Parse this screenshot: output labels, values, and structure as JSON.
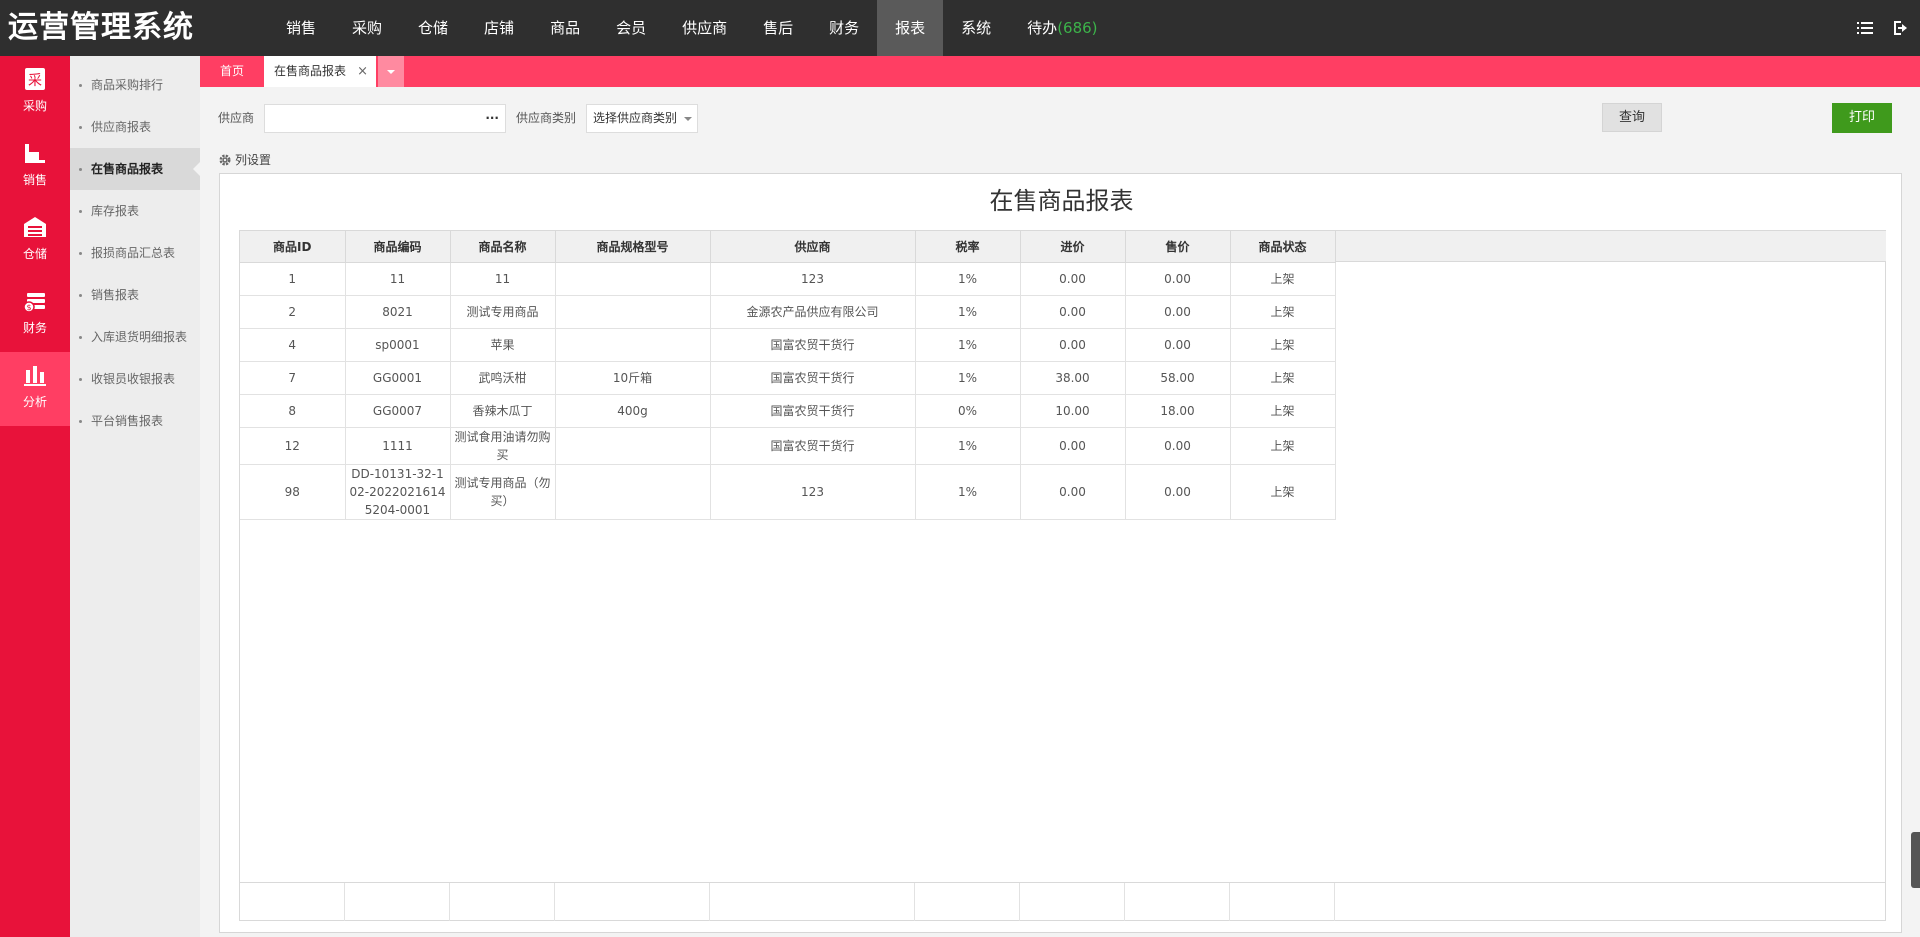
{
  "app": {
    "title": "运营管理系统"
  },
  "topnav": {
    "items": [
      {
        "label": "销售"
      },
      {
        "label": "采购"
      },
      {
        "label": "仓储"
      },
      {
        "label": "店铺"
      },
      {
        "label": "商品"
      },
      {
        "label": "会员"
      },
      {
        "label": "供应商"
      },
      {
        "label": "售后"
      },
      {
        "label": "财务"
      },
      {
        "label": "报表",
        "active": true
      },
      {
        "label": "系统"
      }
    ],
    "todo_label": "待办",
    "todo_count": "(686)"
  },
  "iconbar": {
    "items": [
      {
        "label": "采购",
        "icon": "purchase-icon"
      },
      {
        "label": "销售",
        "icon": "sales-icon"
      },
      {
        "label": "仓储",
        "icon": "warehouse-icon"
      },
      {
        "label": "财务",
        "icon": "finance-icon"
      },
      {
        "label": "分析",
        "icon": "bar-chart-icon",
        "active": true
      }
    ]
  },
  "submenu": {
    "items": [
      {
        "label": "商品采购排行"
      },
      {
        "label": "供应商报表"
      },
      {
        "label": "在售商品报表",
        "active": true
      },
      {
        "label": "库存报表"
      },
      {
        "label": "报损商品汇总表"
      },
      {
        "label": "销售报表"
      },
      {
        "label": "入库退货明细报表"
      },
      {
        "label": "收银员收银报表"
      },
      {
        "label": "平台销售报表"
      }
    ]
  },
  "tabs": {
    "home": "首页",
    "current": "在售商品报表",
    "close": "×"
  },
  "filters": {
    "supplier_label": "供应商",
    "supplier_value": "",
    "supplier_picker": "···",
    "category_label": "供应商类别",
    "category_value": "选择供应商类别",
    "query_button": "查询",
    "print_button": "打印",
    "column_settings": "列设置"
  },
  "report": {
    "title": "在售商品报表",
    "columns": [
      "商品ID",
      "商品编码",
      "商品名称",
      "商品规格型号",
      "供应商",
      "税率",
      "进价",
      "售价",
      "商品状态"
    ],
    "rows": [
      [
        "1",
        "11",
        "11",
        "",
        "123",
        "1%",
        "0.00",
        "0.00",
        "上架"
      ],
      [
        "2",
        "8021",
        "测试专用商品",
        "",
        "金源农产品供应有限公司",
        "1%",
        "0.00",
        "0.00",
        "上架"
      ],
      [
        "4",
        "sp0001",
        "苹果",
        "",
        "国富农贸干货行",
        "1%",
        "0.00",
        "0.00",
        "上架"
      ],
      [
        "7",
        "GG0001",
        "武鸣沃柑",
        "10斤箱",
        "国富农贸干货行",
        "1%",
        "38.00",
        "58.00",
        "上架"
      ],
      [
        "8",
        "GG0007",
        "香辣木瓜丁",
        "400g",
        "国富农贸干货行",
        "0%",
        "10.00",
        "18.00",
        "上架"
      ],
      [
        "12",
        "1111",
        "测试食用油请勿购买",
        "",
        "国富农贸干货行",
        "1%",
        "0.00",
        "0.00",
        "上架"
      ],
      [
        "98",
        "DD-10131-32-102-20220216145204-0001",
        "测试专用商品（勿买）",
        "",
        "123",
        "1%",
        "0.00",
        "0.00",
        "上架"
      ]
    ]
  }
}
